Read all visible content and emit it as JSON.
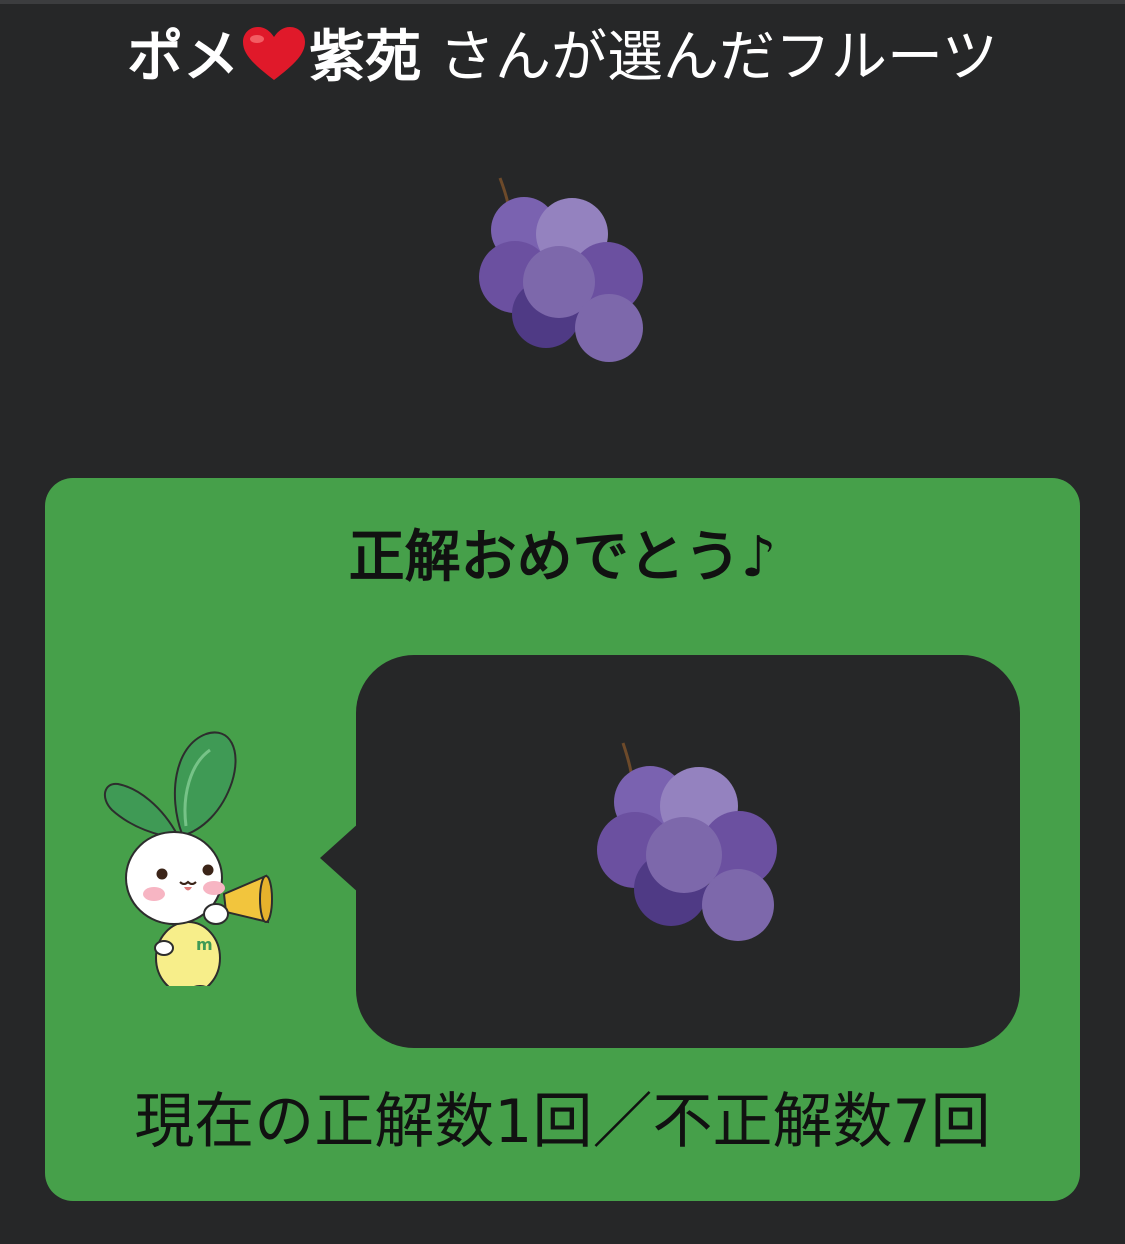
{
  "header": {
    "name_prefix": "ポメ",
    "name_suffix": "紫苑",
    "title_rest": " さんが選んだフルーツ",
    "heart_icon": "red-heart-emoji"
  },
  "selected_fruit": {
    "icon": "grapes-emoji"
  },
  "result": {
    "message": "正解おめでとう♪",
    "bubble_icon": "grapes-emoji",
    "mascot": "radish-rabbit-with-megaphone",
    "score_text": "現在の正解数1回／不正解数7回"
  },
  "colors": {
    "background": "#262728",
    "panel": "#46a04a",
    "heart": "#e0192a",
    "grape_dark": "#4f3a85",
    "grape_mid": "#6b50a0",
    "grape_light": "#9482bf"
  }
}
